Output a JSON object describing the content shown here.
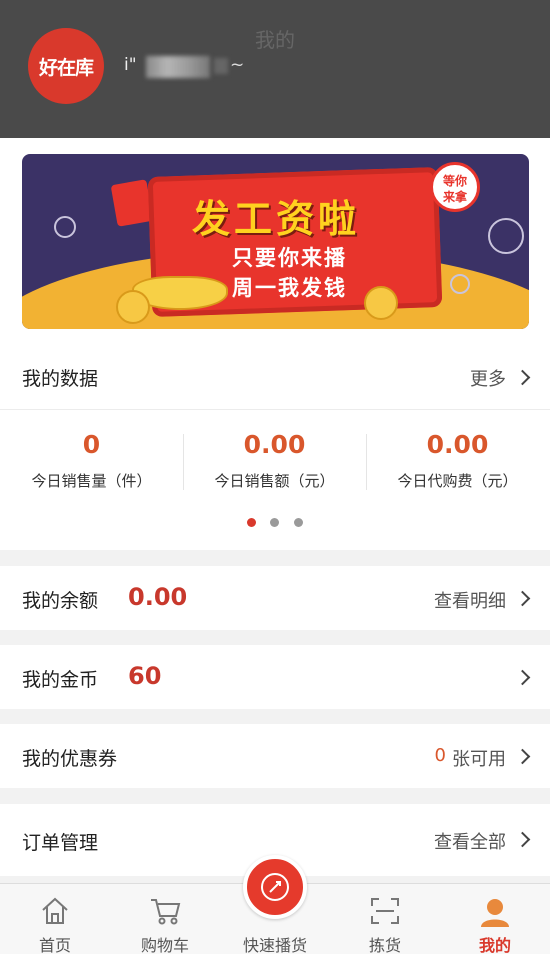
{
  "header": {
    "title": "我的",
    "logo_text": "好在库",
    "username_prefix": "i\"",
    "username_suffix": "~"
  },
  "banner": {
    "headline": "发工资啦",
    "line1": "只要你来播",
    "line2": "周一我发钱",
    "badge_line1": "等你",
    "badge_line2": "来拿"
  },
  "my_data": {
    "title": "我的数据",
    "more_label": "更多",
    "stats": [
      {
        "value": "0",
        "label": "今日销售量（件）"
      },
      {
        "value": "0.00",
        "label": "今日销售额（元）"
      },
      {
        "value": "0.00",
        "label": "今日代购费（元）"
      }
    ],
    "carousel_active_index": 0,
    "carousel_count": 3
  },
  "balance": {
    "label": "我的余额",
    "value": "0.00",
    "action": "查看明细"
  },
  "coins": {
    "label": "我的金币",
    "value": "60"
  },
  "coupons": {
    "label": "我的优惠券",
    "count": "0",
    "suffix": "张可用"
  },
  "orders": {
    "label": "订单管理",
    "action": "查看全部"
  },
  "tabbar": {
    "tabs": [
      {
        "label": "首页",
        "icon": "home-icon"
      },
      {
        "label": "购物车",
        "icon": "cart-icon"
      },
      {
        "label": "快速播货",
        "icon": "broadcast-icon"
      },
      {
        "label": "拣货",
        "icon": "scan-icon"
      },
      {
        "label": "我的",
        "icon": "user-icon"
      }
    ],
    "active_index": 4
  },
  "colors": {
    "accent": "#d9392c",
    "number_orange": "#d9572c",
    "header_bg": "#4a4a4a"
  }
}
